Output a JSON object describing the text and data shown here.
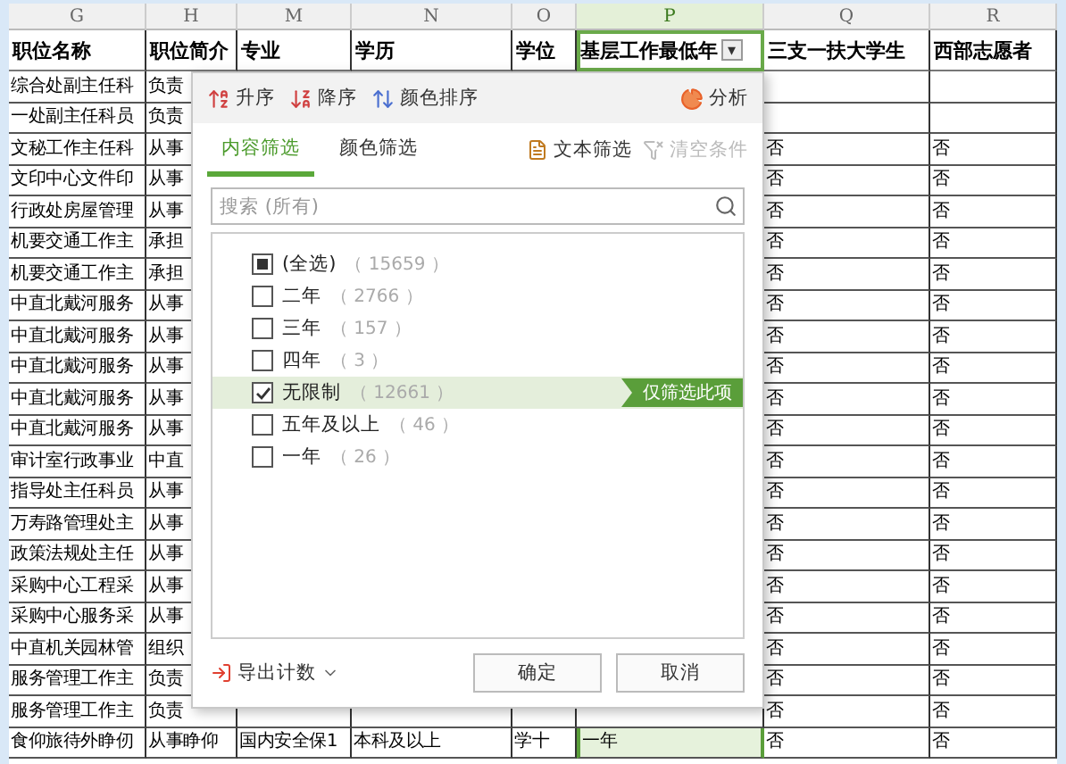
{
  "columns": [
    {
      "letter": "G",
      "header": "职位名称",
      "selected": false
    },
    {
      "letter": "H",
      "header": "职位简介",
      "selected": false
    },
    {
      "letter": "M",
      "header": "专业",
      "selected": false
    },
    {
      "letter": "N",
      "header": "学历",
      "selected": false
    },
    {
      "letter": "O",
      "header": "学位",
      "selected": false
    },
    {
      "letter": "P",
      "header": "基层工作最低年",
      "selected": true,
      "filter_button": "▾"
    },
    {
      "letter": "Q",
      "header": "三支一扶大学生",
      "selected": false
    },
    {
      "letter": "R",
      "header": "西部志愿者",
      "selected": false
    }
  ],
  "rows": [
    {
      "cells": [
        "综合处副主任科",
        "负责"
      ]
    },
    {
      "cells": [
        "一处副主任科员",
        "负责"
      ]
    },
    {
      "cells": [
        "文秘工作主任科",
        "从事",
        null,
        null,
        null,
        null,
        "否",
        "否"
      ]
    },
    {
      "cells": [
        "文印中心文件印",
        "从事",
        null,
        null,
        null,
        null,
        "否",
        "否"
      ]
    },
    {
      "cells": [
        "行政处房屋管理",
        "从事",
        null,
        null,
        null,
        null,
        "否",
        "否"
      ]
    },
    {
      "cells": [
        "机要交通工作主",
        "承担",
        null,
        null,
        null,
        null,
        "否",
        "否"
      ]
    },
    {
      "cells": [
        "机要交通工作主",
        "承担",
        null,
        null,
        null,
        null,
        "否",
        "否"
      ]
    },
    {
      "cells": [
        "中直北戴河服务",
        "从事",
        null,
        null,
        null,
        null,
        "否",
        "否"
      ]
    },
    {
      "cells": [
        "中直北戴河服务",
        "从事",
        null,
        null,
        null,
        null,
        "否",
        "否"
      ]
    },
    {
      "cells": [
        "中直北戴河服务",
        "从事",
        null,
        null,
        null,
        null,
        "否",
        "否"
      ]
    },
    {
      "cells": [
        "中直北戴河服务",
        "从事",
        null,
        null,
        null,
        null,
        "否",
        "否"
      ]
    },
    {
      "cells": [
        "中直北戴河服务",
        "从事",
        null,
        null,
        null,
        null,
        "否",
        "否"
      ]
    },
    {
      "cells": [
        "审计室行政事业",
        "中直",
        null,
        null,
        null,
        null,
        "否",
        "否"
      ]
    },
    {
      "cells": [
        "指导处主任科员",
        "从事",
        null,
        null,
        null,
        null,
        "否",
        "否"
      ]
    },
    {
      "cells": [
        "万寿路管理处主",
        "从事",
        null,
        null,
        null,
        null,
        "否",
        "否"
      ]
    },
    {
      "cells": [
        "政策法规处主任",
        "从事",
        null,
        null,
        null,
        null,
        "否",
        "否"
      ]
    },
    {
      "cells": [
        "采购中心工程采",
        "从事",
        null,
        null,
        null,
        null,
        "否",
        "否"
      ]
    },
    {
      "cells": [
        "采购中心服务采",
        "从事",
        null,
        null,
        null,
        null,
        "否",
        "否"
      ]
    },
    {
      "cells": [
        "中直机关园林管",
        "组织",
        null,
        null,
        null,
        null,
        "否",
        "否"
      ]
    },
    {
      "cells": [
        "服务管理工作主",
        "负责",
        null,
        null,
        null,
        null,
        "否",
        "否"
      ]
    },
    {
      "cells": [
        "服务管理工作主",
        "负责",
        null,
        null,
        null,
        null,
        "否",
        "否"
      ]
    },
    {
      "cells": [
        "食仰旅待外睁仞",
        "从事睁仰",
        "国内安全保1",
        "本科及以上",
        "学十",
        "一年",
        "否",
        "否"
      ]
    }
  ],
  "filter_popup": {
    "sort_buttons": [
      {
        "kind": "ascending",
        "label": "升序"
      },
      {
        "kind": "descending",
        "label": "降序"
      },
      {
        "kind": "color",
        "label": "颜色排序"
      }
    ],
    "analyze_button": "分析",
    "tabs": [
      {
        "label": "内容筛选",
        "selected": true
      },
      {
        "label": "颜色筛选",
        "selected": false
      }
    ],
    "text_filter_button": "文本筛选",
    "clear_button": {
      "label": "清空条件",
      "disabled": true
    },
    "search": {
      "placeholder": "搜索 (所有)"
    },
    "items": [
      {
        "label": "(全选)",
        "count": "（ 15659 ）",
        "checked": false,
        "partial": true,
        "hovered": false
      },
      {
        "label": "二年",
        "count": "（ 2766 ）",
        "checked": false,
        "partial": false,
        "hovered": false
      },
      {
        "label": "三年",
        "count": "（ 157 ）",
        "checked": false,
        "partial": false,
        "hovered": false
      },
      {
        "label": "四年",
        "count": "（ 3 ）",
        "checked": false,
        "partial": false,
        "hovered": false
      },
      {
        "label": "无限制",
        "count": "（ 12661 ）",
        "checked": true,
        "partial": false,
        "hovered": true,
        "action_label": "仅筛选此项"
      },
      {
        "label": "五年及以上",
        "count": "（ 46 ）",
        "checked": false,
        "partial": false,
        "hovered": false
      },
      {
        "label": "一年",
        "count": "（ 26 ）",
        "checked": false,
        "partial": false,
        "hovered": false
      }
    ],
    "export_button": "导出计数",
    "buttons": [
      "确定",
      "取消"
    ]
  }
}
